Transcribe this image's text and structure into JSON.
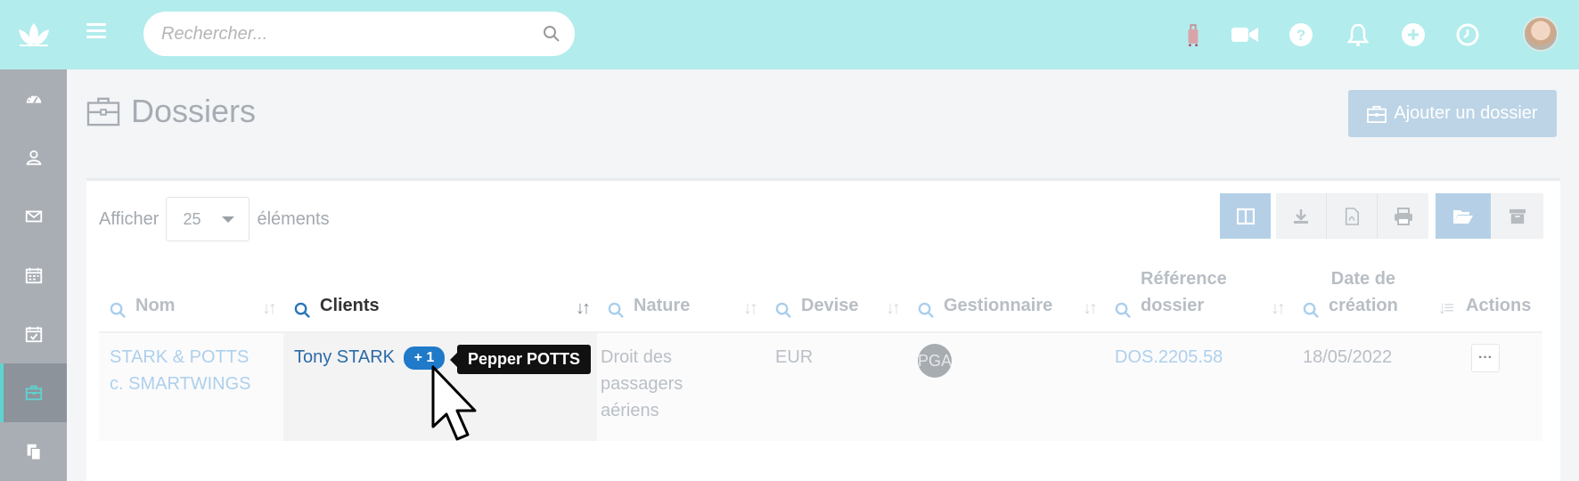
{
  "search": {
    "placeholder": "Rechercher..."
  },
  "page": {
    "title": "Dossiers",
    "add_button": "Ajouter un dossier"
  },
  "listing": {
    "show_label": "Afficher",
    "page_size": "25",
    "elements_label": "éléments"
  },
  "table": {
    "columns": [
      {
        "label": "Nom",
        "sortable": true
      },
      {
        "label": "Clients",
        "sortable": true,
        "active": true
      },
      {
        "label": "Nature",
        "sortable": true
      },
      {
        "label": "Devise",
        "sortable": true
      },
      {
        "label": "Gestionnaire",
        "sortable": true
      },
      {
        "label_line1": "Référence",
        "label_line2": "dossier",
        "sortable": true
      },
      {
        "label_line1": "Date de",
        "label_line2": "création",
        "sortable": true
      },
      {
        "label": "Actions"
      }
    ],
    "rows": [
      {
        "nom_line1": "STARK & POTTS",
        "nom_line2": "c. SMARTWINGS",
        "client": "Tony STARK",
        "client_badge": "+ 1",
        "nature_line1": "Droit des",
        "nature_line2": "passagers",
        "nature_line3": "aériens",
        "devise": "EUR",
        "gestionnaire_initials": "PGA",
        "reference": "DOS.2205.58",
        "date_creation": "18/05/2022",
        "actions": "···"
      }
    ]
  },
  "tooltip": {
    "text": "Pepper POTTS"
  },
  "colors": {
    "topbar": "#b2ecec",
    "sidebar": "#a9aeb5",
    "badge": "#1f7ac9",
    "primary_link": "#2c6aa6"
  },
  "icons": {
    "sidebar": [
      "dashboard-icon",
      "contacts-icon",
      "mail-icon",
      "calendar-icon",
      "calendar-check-icon",
      "briefcase-icon",
      "documents-icon"
    ],
    "topbar": [
      "luggage-icon",
      "video-camera-icon",
      "help-icon",
      "bell-icon",
      "plus-circle-icon",
      "clock-icon"
    ],
    "toolbar": [
      "columns-icon",
      "download-icon",
      "pdf-icon",
      "print-icon",
      "folder-open-icon",
      "archive-icon"
    ]
  }
}
